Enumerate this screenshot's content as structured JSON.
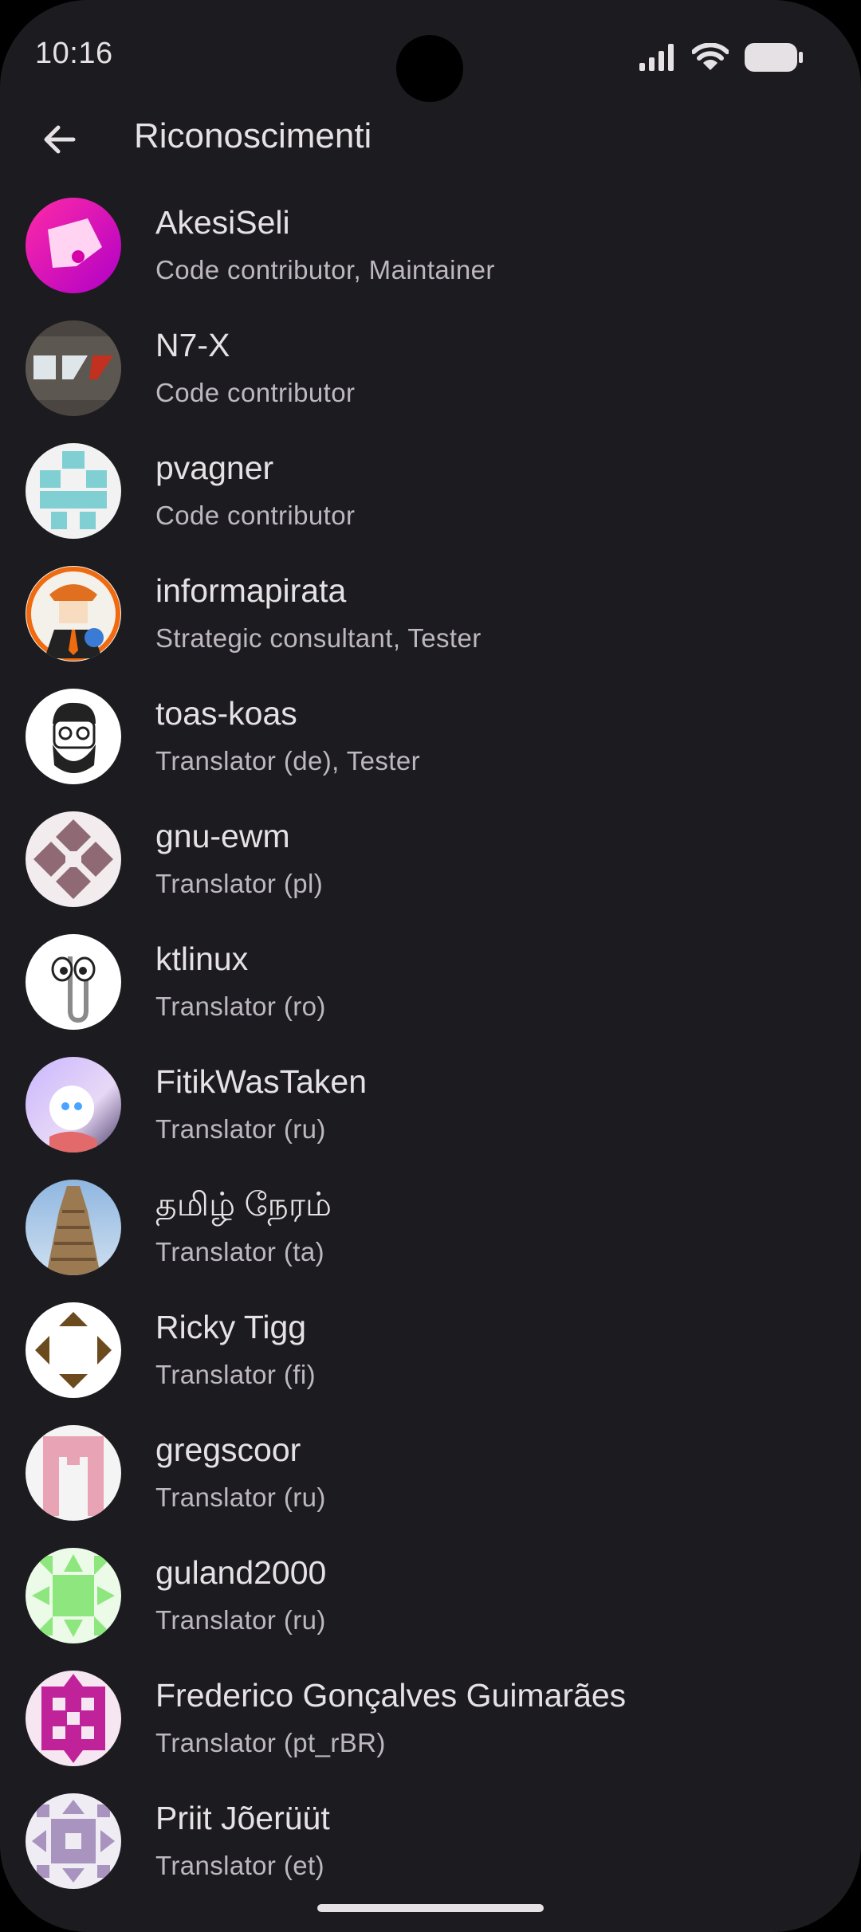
{
  "status_bar": {
    "time": "10:16"
  },
  "app_bar": {
    "title": "Riconoscimenti"
  },
  "contributors": [
    {
      "name": "AkesiSeli",
      "role": "Code contributor, Maintainer"
    },
    {
      "name": "N7-X",
      "role": "Code contributor"
    },
    {
      "name": "pvagner",
      "role": "Code contributor"
    },
    {
      "name": "informapirata",
      "role": "Strategic consultant, Tester"
    },
    {
      "name": "toas-koas",
      "role": "Translator (de), Tester"
    },
    {
      "name": "gnu-ewm",
      "role": "Translator (pl)"
    },
    {
      "name": "ktlinux",
      "role": "Translator (ro)"
    },
    {
      "name": "FitikWasTaken",
      "role": "Translator (ru)"
    },
    {
      "name": "தமிழ் நேரம்",
      "role": "Translator (ta)"
    },
    {
      "name": "Ricky Tigg",
      "role": "Translator (fi)"
    },
    {
      "name": "gregscoor",
      "role": "Translator (ru)"
    },
    {
      "name": "guland2000",
      "role": "Translator (ru)"
    },
    {
      "name": "Frederico Gonçalves Guimarães",
      "role": "Translator (pt_rBR)"
    },
    {
      "name": "Priit Jõerüüt",
      "role": "Translator (et)"
    }
  ],
  "icons": {
    "back": "arrow-back-icon",
    "signal": "cellular-signal-icon",
    "wifi": "wifi-icon",
    "battery": "battery-icon"
  },
  "colors": {
    "background": "#1c1b1f",
    "text_primary": "#e6e1e5",
    "text_secondary": "#bdb8c0"
  }
}
